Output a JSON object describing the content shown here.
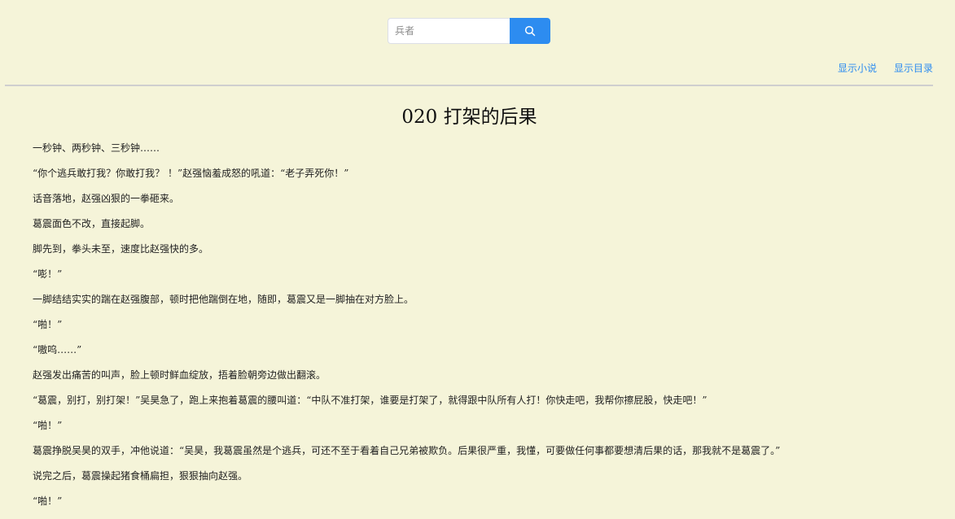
{
  "search": {
    "placeholder": "兵者",
    "button_icon": "search-icon",
    "button_color": "#2d8cf0"
  },
  "top_links": {
    "show_novel": "显示小说",
    "show_toc": "显示目录"
  },
  "chapter": {
    "title": "020 打架的后果",
    "paragraphs": [
      "一秒钟、两秒钟、三秒钟……",
      "“你个逃兵敢打我？你敢打我？ ！”赵强恼羞成怒的吼道：“老子弄死你！”",
      "话音落地，赵强凶狠的一拳砸来。",
      "葛震面色不改，直接起脚。",
      "脚先到，拳头未至，速度比赵强快的多。",
      "“嘭！”",
      "一脚结结实实的踹在赵强腹部，顿时把他踹倒在地，随即，葛震又是一脚抽在对方脸上。",
      "“啪！”",
      "“嗷呜……”",
      "赵强发出痛苦的叫声，脸上顿时鲜血绽放，捂着脸朝旁边做出翻滚。",
      "“葛震，别打，别打架！”吴昊急了，跑上来抱着葛震的腰叫道：“中队不准打架，谁要是打架了，就得跟中队所有人打！你快走吧，我帮你擦屁股，快走吧！”",
      "“啪！”",
      "葛震挣脱吴昊的双手，冲他说道：“吴昊，我葛震虽然是个逃兵，可还不至于看着自己兄弟被欺负。后果很严重，我懂，可要做任何事都要想清后果的话，那我就不是葛震了。”",
      "说完之后，葛震操起猪食桶扁担，狠狠抽向赵强。",
      "“啪！”"
    ]
  },
  "colors": {
    "background": "#f5f4d9",
    "link": "#2d8cf0",
    "divider": "#cfcfcf"
  }
}
